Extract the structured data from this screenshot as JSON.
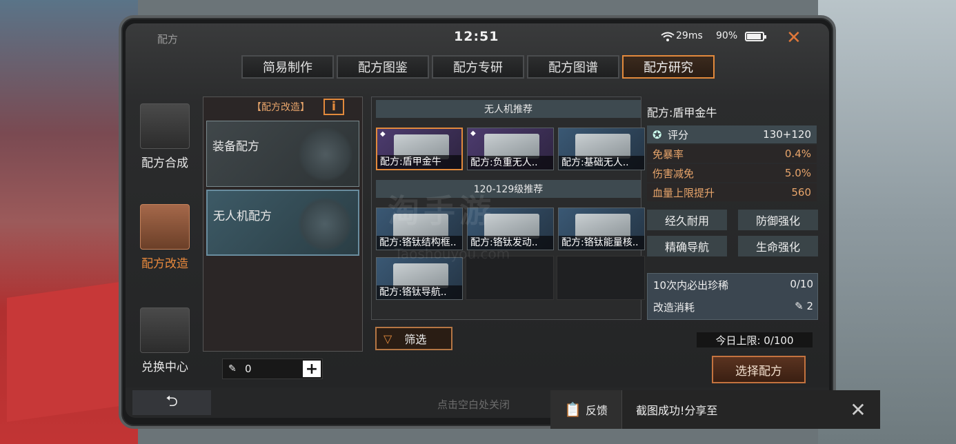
{
  "window": {
    "title": "配方",
    "clock": "12:51",
    "ping": "29ms",
    "battery": "90%"
  },
  "tabs": [
    "简易制作",
    "配方图鉴",
    "配方专研",
    "配方图谱",
    "配方研究"
  ],
  "active_tab": 4,
  "sidebar": [
    {
      "label": "配方合成",
      "icon": "terminal-icon"
    },
    {
      "label": "配方改造",
      "icon": "notepad-pencil-icon"
    },
    {
      "label": "兑换中心",
      "icon": "shopping-bag-icon"
    }
  ],
  "left_panel": {
    "header": "【配方改造】",
    "info_glyph": "i",
    "cards": [
      {
        "label": "装备配方"
      },
      {
        "label": "无人机配方"
      }
    ],
    "stylus_count": "0",
    "plus": "+"
  },
  "middle": {
    "section1": "无人机推荐",
    "section2": "120-129级推荐",
    "recommended": [
      "配方:盾甲金牛",
      "配方:负重无人..",
      "配方:基础无人.."
    ],
    "level_items": [
      "配方:铬钛结构框..",
      "配方:铬钛发动..",
      "配方:铬钛能量核..",
      "配方:铬钛导航.."
    ],
    "filter_label": "筛选",
    "watermark": "淘手游",
    "watermark2": "Taoshouyou.com"
  },
  "detail": {
    "title": "配方:盾甲金牛",
    "score_label": "评分",
    "score_value": "130+120",
    "attrs": [
      {
        "label": "免暴率",
        "value": "0.4%"
      },
      {
        "label": "伤害减免",
        "value": "5.0%"
      },
      {
        "label": "血量上限提升",
        "value": "560"
      }
    ],
    "tags": [
      "经久耐用",
      "防御强化",
      "精确导航",
      "生命强化"
    ],
    "rarity_label": "10次内必出珍稀",
    "rarity_value": "0/10",
    "cost_label": "改造消耗",
    "cost_value": "2"
  },
  "daily_limit": "今日上限: 0/100",
  "select_button": "选择配方",
  "close_hint": "点击空白处关闭",
  "back_glyph": "⮌",
  "toast": {
    "feedback": "反馈",
    "message": "截图成功!分享至",
    "close": "✕"
  }
}
